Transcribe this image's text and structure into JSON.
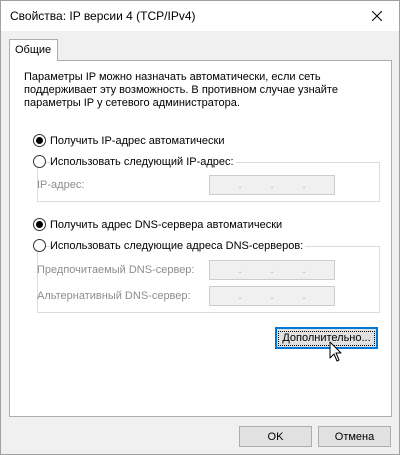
{
  "window": {
    "title": "Свойства: IP версии 4 (TCP/IPv4)",
    "close_icon": "close-icon"
  },
  "tabs": [
    {
      "label": "Общие",
      "active": true
    }
  ],
  "general": {
    "description": "Параметры IP можно назначать автоматически, если сеть поддерживает эту возможность. В противном случае узнайте параметры IP у сетевого администратора.",
    "ip_auto_label": "Получить IP-адрес автоматически",
    "ip_auto_checked": true,
    "ip_manual_label": "Использовать следующий IP-адрес:",
    "ip_manual_checked": false,
    "ip_address_label": "IP-адрес:",
    "ip_address_value": ". . .",
    "dns_auto_label": "Получить адрес DNS-сервера автоматически",
    "dns_auto_checked": true,
    "dns_manual_label": "Использовать следующие адреса DNS-серверов:",
    "dns_manual_checked": false,
    "preferred_dns_label": "Предпочитаемый DNS-сервер:",
    "alternate_dns_label": "Альтернативный DNS-сервер:",
    "advanced_button": "Дополнительно..."
  },
  "footer": {
    "ok_button": "OK",
    "cancel_button": "Отмена"
  },
  "colors": {
    "focus_border": "#0078d7",
    "disabled_text": "#8d8d8d"
  }
}
